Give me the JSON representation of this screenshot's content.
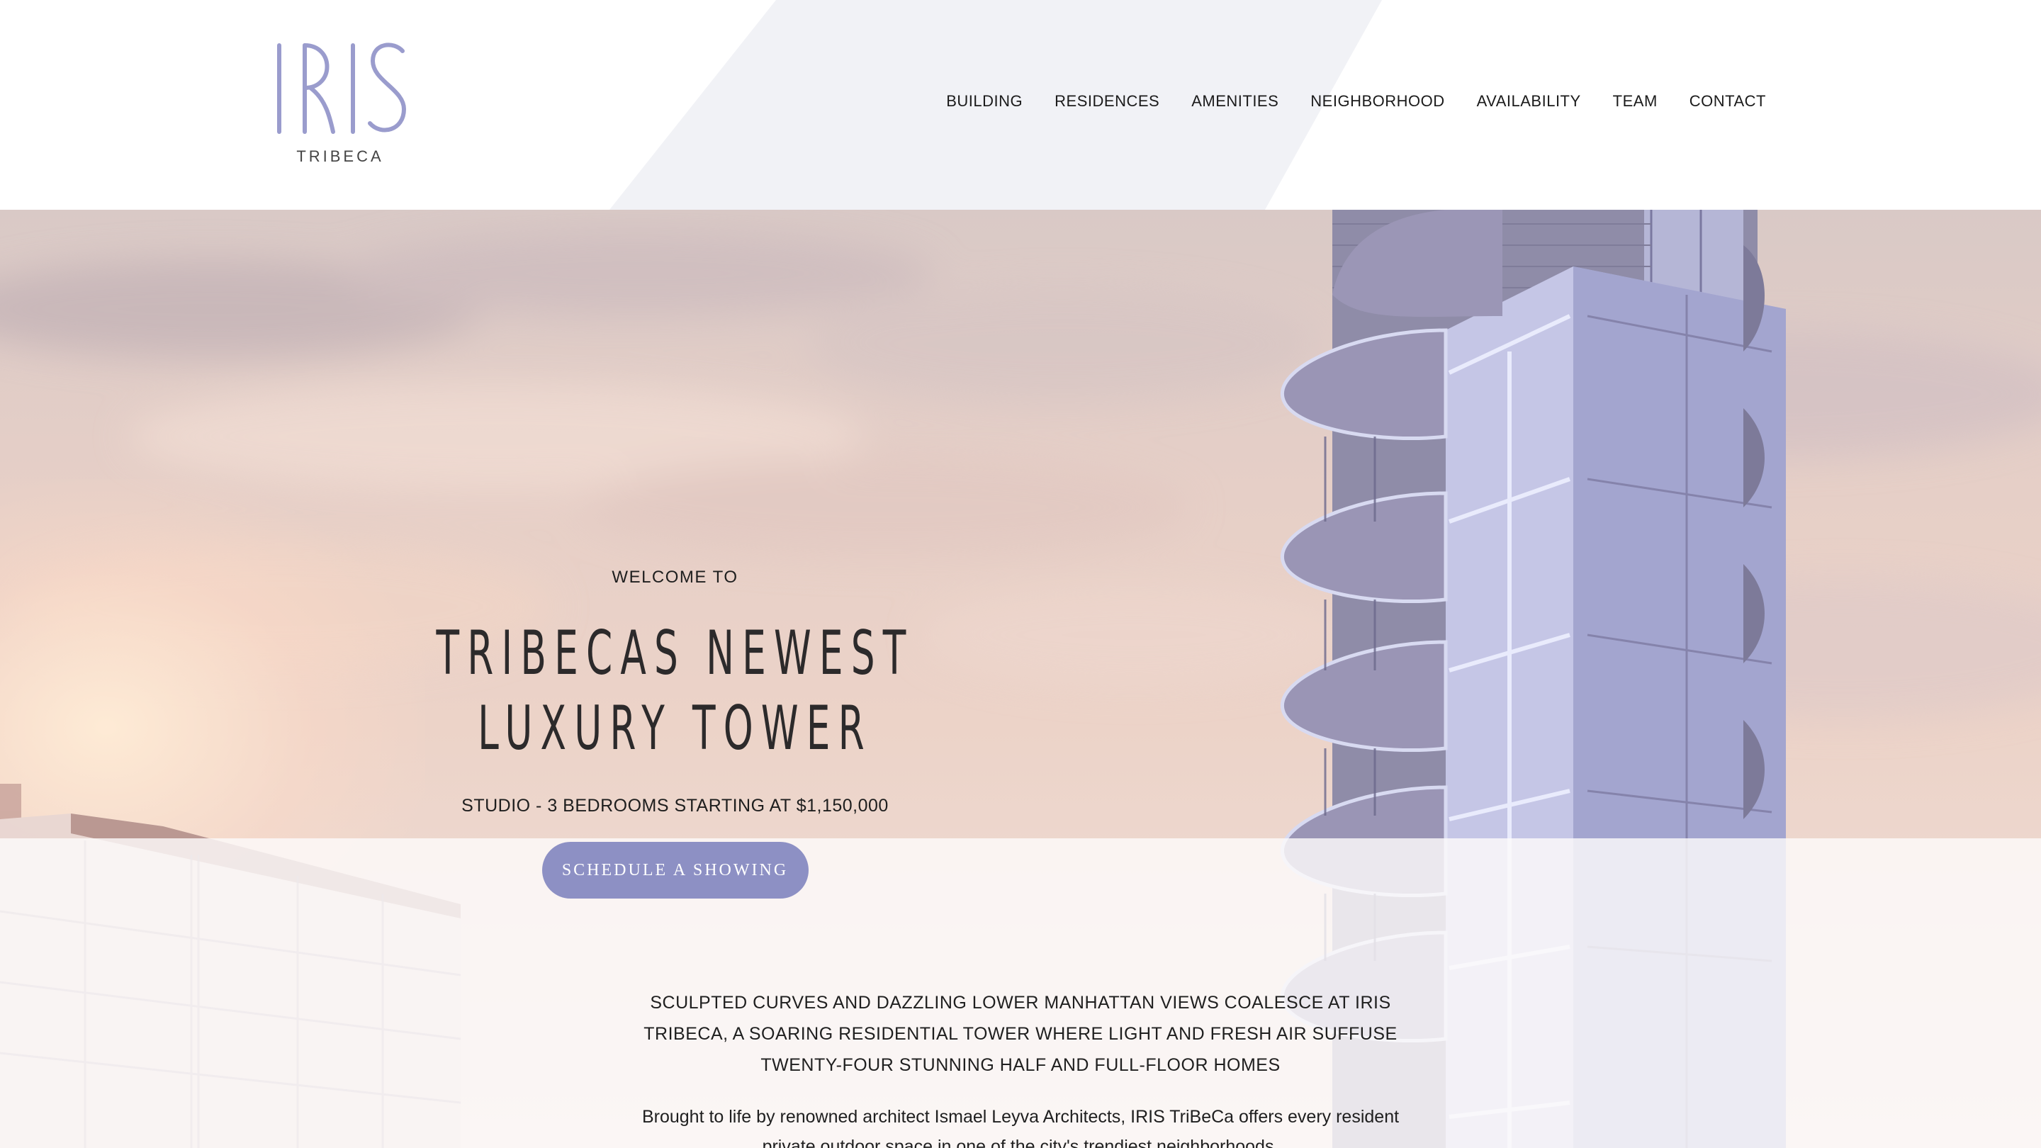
{
  "brand": {
    "logo_text": "IRIS",
    "logo_sub": "TRIBECA",
    "accent_color": "#8d90c4"
  },
  "nav": {
    "items": [
      "BUILDING",
      "RESIDENCES",
      "AMENITIES",
      "NEIGHBORHOOD",
      "AVAILABILITY",
      "TEAM",
      "CONTACT"
    ]
  },
  "hero": {
    "eyebrow": "WELCOME TO",
    "headline_line1": "TRIBECAS NEWEST",
    "headline_line2": "LUXURY TOWER",
    "subline": "STUDIO - 3 BEDROOMS STARTING AT $1,150,000",
    "cta_label": "Schedule a showing"
  },
  "intro": {
    "caps": "Sculpted curves and dazzling Lower Manhattan views coalesce at IRIS TriBeCa, a soaring residential tower where light and fresh air suffuse twenty-four stunning half and full-floor homes",
    "body": "Brought to life by renowned architect Ismael Leyva Architects, IRIS TriBeCa offers every resident private outdoor space in one of the city's trendiest neighborhoods."
  }
}
